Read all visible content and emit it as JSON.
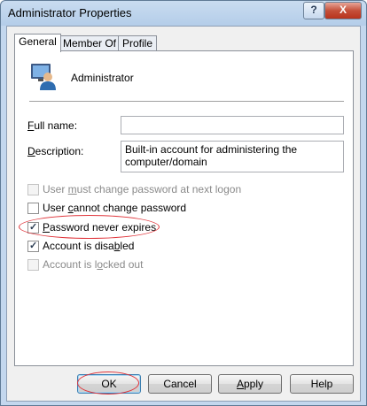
{
  "window": {
    "title": "Administrator Properties",
    "help_glyph": "?",
    "close_glyph": "X"
  },
  "tabs": [
    {
      "label": "General",
      "active": true
    },
    {
      "label": "Member Of",
      "active": false
    },
    {
      "label": "Profile",
      "active": false
    }
  ],
  "general": {
    "account_name": "Administrator",
    "full_name_label": "Full name:",
    "full_name_value": "",
    "description_label": "Description:",
    "description_value": "Built-in account for administering the computer/domain",
    "checkboxes": [
      {
        "label": "User must change password at next logon",
        "checked": false,
        "enabled": false
      },
      {
        "label": "User cannot change password",
        "checked": false,
        "enabled": true
      },
      {
        "label": "Password never expires",
        "checked": true,
        "enabled": true
      },
      {
        "label": "Account is disabled",
        "checked": true,
        "enabled": true
      },
      {
        "label": "Account is locked out",
        "checked": false,
        "enabled": false
      }
    ]
  },
  "buttons": {
    "ok": "OK",
    "cancel": "Cancel",
    "apply": "Apply",
    "help": "Help"
  },
  "colors": {
    "highlight": "#e0343a",
    "title_bar": "#b4cde9",
    "close_button": "#c5503a"
  },
  "icons": {
    "user": "user-account-icon"
  }
}
